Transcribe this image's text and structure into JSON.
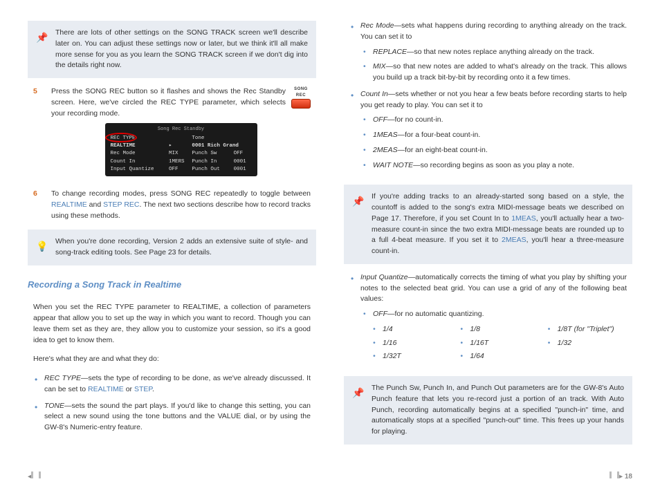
{
  "left": {
    "callout1": {
      "text": "There are lots of other settings on the SONG TRACK screen we'll describe later on. You can adjust these settings now or later, but we think it'll all make more sense for you as you learn the SONG TRACK screen if we don't dig into the details right now."
    },
    "step5": {
      "num": "5",
      "text": "Press the SONG REC button so it flashes and shows the Rec Standby screen. Here, we've circled the REC TYPE parameter, which selects your recording mode.",
      "badge": "SONG REC"
    },
    "lcd": {
      "title": "Song Rec Standby",
      "r1a": "REC TYPE",
      "r1b": "Tone",
      "r2a": "REALTIME",
      "r2b": "0001 Rich Grand",
      "r3a": "Rec Mode",
      "r3b": "MIX",
      "r3c": "Punch Sw",
      "r3d": "OFF",
      "r4a": "Count In",
      "r4b": "1MERS",
      "r4c": "Punch In",
      "r4d": "0001",
      "r5a": "Input Quantize",
      "r5b": "OFF",
      "r5c": "Punch Out",
      "r5d": "0001"
    },
    "step6": {
      "num": "6",
      "pre": "To change recording modes, press SONG REC repeatedly to toggle between ",
      "link1": "REALTIME",
      "mid": " and ",
      "link2": "STEP REC",
      "post": ". The next two sections describe how to record tracks using these methods."
    },
    "callout2": {
      "text": "When you're done recording, Version 2 adds an extensive suite of style- and song-track editing tools. See Page 23 for details."
    },
    "heading": "Recording a Song Track in Realtime",
    "p1": "When you set the REC TYPE parameter to REALTIME, a collection of parameters appear that allow you to set up the way in which you want to record. Though you can leave them set as they are, they allow you to customize your session, so it's a good idea to get to know them.",
    "p2": "Here's what they are and what they do:",
    "bullets": [
      {
        "term": "REC TYPE",
        "pre": "—sets the type of recording to be done, as we've already discussed. It can be set to ",
        "link1": "REALTIME",
        "mid": " or ",
        "link2": "STEP",
        "post": "."
      },
      {
        "term": "TONE",
        "text": "—sets the sound the part plays. If you'd like to change this setting, you can select a new sound using the tone buttons and the VALUE dial, or by using the GW-8's Numeric-entry feature."
      }
    ]
  },
  "right": {
    "recmode": {
      "term": "Rec Mode",
      "text": "—sets what happens during recording to anything already on the track. You can set it to",
      "sub": [
        {
          "term": "REPLACE",
          "text": "—so that new notes replace anything already on the track."
        },
        {
          "term": "MIX",
          "text": "—so that new notes are added to what's already on the track. This allows you build up a track bit-by-bit by recording onto it a few times."
        }
      ]
    },
    "countin": {
      "term": "Count In",
      "text": "—sets whether or not you hear a few beats before recording starts to help you get ready to play. You can set it to",
      "sub": [
        {
          "term": "OFF",
          "text": "—for no count-in."
        },
        {
          "term": "1MEAS",
          "text": "—for a four-beat count-in."
        },
        {
          "term": "2MEAS",
          "text": "—for an eight-beat count-in."
        },
        {
          "term": "WAIT NOTE",
          "text": "—so recording begins as soon as you play a note."
        }
      ]
    },
    "callout3": {
      "pre": "If you're adding tracks to an already-started song based on a style, the countoff is added to the song's extra MIDI-message beats we described on Page 17. Therefore, if you set Count In to ",
      "link1": "1MEAS",
      "mid": ", you'll actually hear a two-measure count-in since the two extra MIDI-message beats are rounded up to a full 4-beat measure. If you set it to ",
      "link2": "2MEAS",
      "post": ", you'll hear a three-measure count-in."
    },
    "quantize": {
      "term": "Input Quantize",
      "text": "—automatically corrects the timing of what you play by shifting your notes to the selected beat grid. You can use a grid of any of the following beat values:",
      "off": {
        "term": "OFF",
        "text": "—for no automatic quantizing."
      },
      "grid": [
        "1/4",
        "1/8",
        "1/8T (for \"Triplet\")",
        "1/16",
        "1/16T",
        "1/32",
        "1/32T",
        "1/64"
      ]
    },
    "callout4": {
      "text": "The Punch Sw, Punch In, and Punch Out parameters are for the GW-8's Auto Punch feature that lets you re-record just a portion of an track. With Auto Punch, recording automatically begins at a specified \"punch-in\" time, and automatically stops at a specified \"punch-out\" time. This frees up your hands for playing."
    }
  },
  "pagenum": "18"
}
